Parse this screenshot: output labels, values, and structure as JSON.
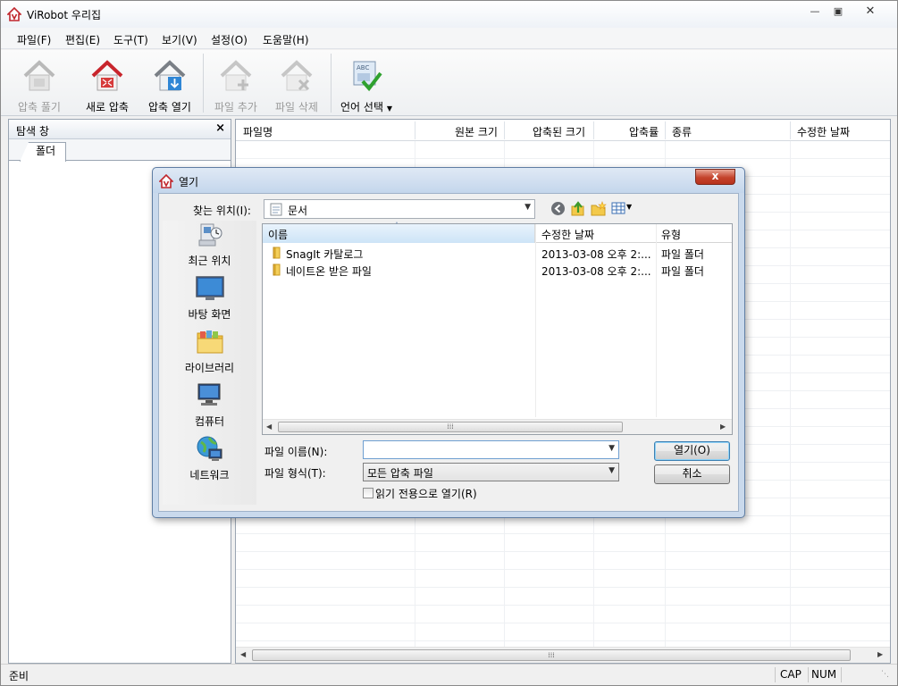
{
  "window": {
    "title": "ViRobot 우리집"
  },
  "menu": [
    "파일(F)",
    "편집(E)",
    "도구(T)",
    "보기(V)",
    "설정(O)",
    "도움말(H)"
  ],
  "toolbar": {
    "extract": "압축 풀기",
    "new_archive": "새로 압축",
    "open_archive": "압축 열기",
    "add_file": "파일 추가",
    "delete_file": "파일 삭제",
    "language": "언어 선택"
  },
  "explorer": {
    "title": "탐색 창",
    "close": "×",
    "tab": "폴더"
  },
  "list": {
    "columns": [
      "파일명",
      "원본 크기",
      "압축된 크기",
      "압축률",
      "종류",
      "수정한 날짜"
    ]
  },
  "status": {
    "text": "준비",
    "cap": "CAP",
    "num": "NUM"
  },
  "dialog": {
    "title": "열기",
    "close": "x",
    "look_in_label": "찾는 위치(I):",
    "look_in_value": "문서",
    "places": [
      "최근 위치",
      "바탕 화면",
      "라이브러리",
      "컴퓨터",
      "네트워크"
    ],
    "columns": [
      "이름",
      "수정한 날짜",
      "유형"
    ],
    "files": [
      {
        "name": "SnagIt 카탈로그",
        "date": "2013-03-08 오후 2:...",
        "type": "파일 폴더"
      },
      {
        "name": "네이트온 받은 파일",
        "date": "2013-03-08 오후 2:...",
        "type": "파일 폴더"
      }
    ],
    "filename_label": "파일 이름(N):",
    "filename_value": "",
    "filetype_label": "파일 형식(T):",
    "filetype_value": "모든 압축 파일",
    "readonly_label": "읽기 전용으로 열기(R)",
    "open_button": "열기(O)",
    "cancel_button": "취소"
  }
}
